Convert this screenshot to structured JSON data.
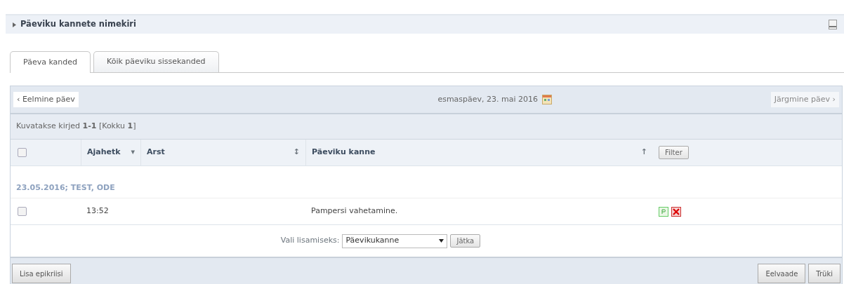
{
  "panel": {
    "title": "Päeviku kannete nimekiri",
    "expanded": true
  },
  "tabs": [
    {
      "label": "Päeva kanded",
      "selected": true
    },
    {
      "label": "Kõik päeviku sissekanded",
      "selected": false
    }
  ],
  "day_nav": {
    "previous": {
      "label": "‹ Eelmine päev",
      "disabled": false
    },
    "date": "esmaspäev, 23. mai 2016",
    "next": {
      "label": "Järgmine päev ›",
      "disabled": true
    }
  },
  "records_info": "Kuvatakse kirjed **1-1** [Kokku **1**]",
  "table": {
    "select_all_checked": false,
    "columns": [
      {
        "label": "Ajahetk",
        "sort": "▾"
      },
      {
        "label": "Arst",
        "sort": "↕"
      },
      {
        "label": "Päeviku kanne",
        "sort": "↑"
      }
    ],
    "filter_button": "Filter",
    "groups": [
      {
        "title": "23.05.2016; TEST, ODE",
        "rows": [
          {
            "checked": false,
            "time": "13:52",
            "doctor": "",
            "entry": "Pampersi vahetamine."
          }
        ]
      }
    ]
  },
  "add": {
    "label": "Vali lisamiseks:",
    "value": "Päevikukanne",
    "button": "Jätka"
  },
  "footer": {
    "left": [
      "Lisa epikriisi"
    ],
    "right": [
      "Eelvaade",
      "Trüki"
    ]
  }
}
